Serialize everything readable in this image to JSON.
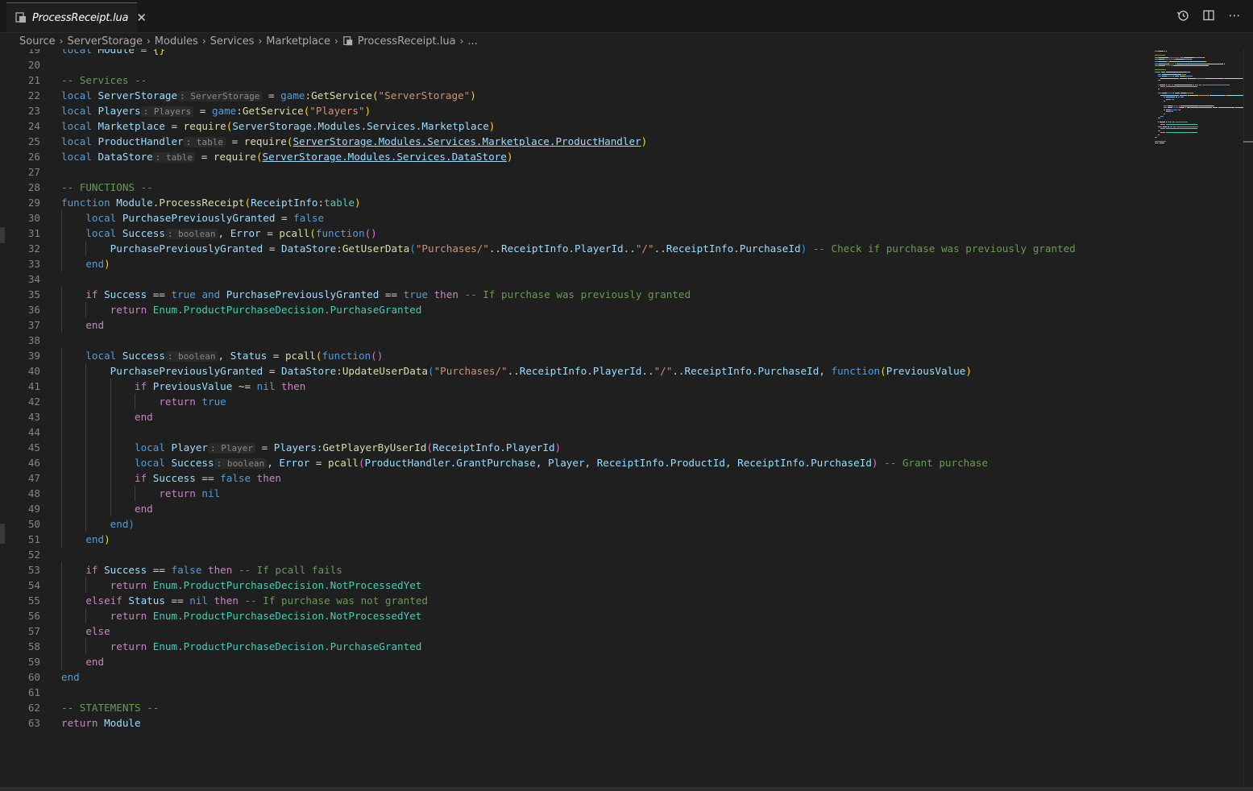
{
  "tab": {
    "title": "ProcessReceipt.lua",
    "close": "✕"
  },
  "actions": {
    "history": "⟲",
    "split": "◫",
    "more": "⋯"
  },
  "breadcrumb": [
    "Source",
    "ServerStorage",
    "Modules",
    "Services",
    "Marketplace",
    "ProcessReceipt.lua",
    "..."
  ],
  "code_lines": [
    {
      "n": "19",
      "t": [
        [
          "kw",
          "local "
        ],
        [
          "id",
          "Module "
        ],
        [
          "pl",
          "= "
        ],
        [
          "br1",
          "{}"
        ]
      ]
    },
    {
      "n": "20",
      "t": []
    },
    {
      "n": "21",
      "t": [
        [
          "cm",
          "-- Services --"
        ]
      ]
    },
    {
      "n": "22",
      "t": [
        [
          "kw",
          "local "
        ],
        [
          "id",
          "ServerStorage"
        ],
        [
          "hint",
          ": ServerStorage"
        ],
        [
          "pl",
          " = "
        ],
        [
          "kw",
          "game"
        ],
        [
          "pl",
          ":"
        ],
        [
          "fn",
          "GetService"
        ],
        [
          "br1",
          "("
        ],
        [
          "str",
          "\"ServerStorage\""
        ],
        [
          "br1",
          ")"
        ]
      ]
    },
    {
      "n": "23",
      "t": [
        [
          "kw",
          "local "
        ],
        [
          "id",
          "Players"
        ],
        [
          "hint",
          ": Players"
        ],
        [
          "pl",
          " = "
        ],
        [
          "kw",
          "game"
        ],
        [
          "pl",
          ":"
        ],
        [
          "fn",
          "GetService"
        ],
        [
          "br1",
          "("
        ],
        [
          "str",
          "\"Players\""
        ],
        [
          "br1",
          ")"
        ]
      ]
    },
    {
      "n": "24",
      "t": [
        [
          "kw",
          "local "
        ],
        [
          "id",
          "Marketplace "
        ],
        [
          "pl",
          "= "
        ],
        [
          "fn",
          "require"
        ],
        [
          "br1",
          "("
        ],
        [
          "id",
          "ServerStorage.Modules.Services.Marketplace"
        ],
        [
          "br1",
          ")"
        ]
      ]
    },
    {
      "n": "25",
      "t": [
        [
          "kw",
          "local "
        ],
        [
          "id",
          "ProductHandler"
        ],
        [
          "hint",
          ": table"
        ],
        [
          "pl",
          " = "
        ],
        [
          "fn",
          "require"
        ],
        [
          "br1",
          "("
        ],
        [
          "idu",
          "ServerStorage.Modules.Services.Marketplace.ProductHandler"
        ],
        [
          "br1",
          ")"
        ]
      ]
    },
    {
      "n": "26",
      "t": [
        [
          "kw",
          "local "
        ],
        [
          "id",
          "DataStore"
        ],
        [
          "hint",
          ": table"
        ],
        [
          "pl",
          " = "
        ],
        [
          "fn",
          "require"
        ],
        [
          "br1",
          "("
        ],
        [
          "idu",
          "ServerStorage.Modules.Services.DataStore"
        ],
        [
          "br1",
          ")"
        ]
      ]
    },
    {
      "n": "27",
      "t": []
    },
    {
      "n": "28",
      "t": [
        [
          "cm",
          "-- FUNCTIONS --"
        ]
      ]
    },
    {
      "n": "29",
      "t": [
        [
          "kw",
          "function "
        ],
        [
          "id",
          "Module"
        ],
        [
          "pl",
          "."
        ],
        [
          "fn",
          "ProcessReceipt"
        ],
        [
          "br1",
          "("
        ],
        [
          "id",
          "ReceiptInfo"
        ],
        [
          "pl",
          ":"
        ],
        [
          "ty",
          "table"
        ],
        [
          "br1",
          ")"
        ]
      ]
    },
    {
      "n": "30",
      "g": [
        0
      ],
      "t": [
        [
          "pl",
          "    "
        ],
        [
          "kw",
          "local "
        ],
        [
          "id",
          "PurchasePreviouslyGranted "
        ],
        [
          "pl",
          "= "
        ],
        [
          "kw",
          "false"
        ]
      ]
    },
    {
      "n": "31",
      "g": [
        0
      ],
      "t": [
        [
          "pl",
          "    "
        ],
        [
          "kw",
          "local "
        ],
        [
          "id",
          "Success"
        ],
        [
          "hint",
          ": boolean"
        ],
        [
          "pl",
          ", "
        ],
        [
          "id",
          "Error "
        ],
        [
          "pl",
          "= "
        ],
        [
          "fn",
          "pcall"
        ],
        [
          "br1",
          "("
        ],
        [
          "kw",
          "function"
        ],
        [
          "br2",
          "()"
        ]
      ]
    },
    {
      "n": "32",
      "g": [
        0,
        1
      ],
      "t": [
        [
          "pl",
          "        "
        ],
        [
          "id",
          "PurchasePreviouslyGranted "
        ],
        [
          "pl",
          "= "
        ],
        [
          "id",
          "DataStore"
        ],
        [
          "pl",
          ":"
        ],
        [
          "fn",
          "GetUserData"
        ],
        [
          "br3",
          "("
        ],
        [
          "str",
          "\"Purchases/\""
        ],
        [
          "pl",
          ".."
        ],
        [
          "id",
          "ReceiptInfo.PlayerId"
        ],
        [
          "pl",
          ".."
        ],
        [
          "str",
          "\"/\""
        ],
        [
          "pl",
          ".."
        ],
        [
          "id",
          "ReceiptInfo.PurchaseId"
        ],
        [
          "br3",
          ")"
        ],
        [
          "cm",
          " -- Check if purchase was previously granted"
        ]
      ]
    },
    {
      "n": "33",
      "g": [
        0
      ],
      "t": [
        [
          "pl",
          "    "
        ],
        [
          "kw",
          "end"
        ],
        [
          "br1",
          ")"
        ]
      ]
    },
    {
      "n": "34",
      "t": []
    },
    {
      "n": "35",
      "g": [
        0
      ],
      "t": [
        [
          "pl",
          "    "
        ],
        [
          "ctl",
          "if "
        ],
        [
          "id",
          "Success "
        ],
        [
          "pl",
          "== "
        ],
        [
          "kw",
          "true "
        ],
        [
          "kw",
          "and "
        ],
        [
          "id",
          "PurchasePreviouslyGranted "
        ],
        [
          "pl",
          "== "
        ],
        [
          "kw",
          "true "
        ],
        [
          "ctl",
          "then "
        ],
        [
          "cm",
          "-- If purchase was previously granted"
        ]
      ]
    },
    {
      "n": "36",
      "g": [
        0,
        1
      ],
      "t": [
        [
          "pl",
          "        "
        ],
        [
          "ctl",
          "return "
        ],
        [
          "ty",
          "Enum.ProductPurchaseDecision.PurchaseGranted"
        ]
      ]
    },
    {
      "n": "37",
      "g": [
        0
      ],
      "t": [
        [
          "pl",
          "    "
        ],
        [
          "ctl",
          "end"
        ]
      ]
    },
    {
      "n": "38",
      "t": []
    },
    {
      "n": "39",
      "g": [
        0
      ],
      "t": [
        [
          "pl",
          "    "
        ],
        [
          "kw",
          "local "
        ],
        [
          "id",
          "Success"
        ],
        [
          "hint",
          ": boolean"
        ],
        [
          "pl",
          ", "
        ],
        [
          "id",
          "Status "
        ],
        [
          "pl",
          "= "
        ],
        [
          "fn",
          "pcall"
        ],
        [
          "br1",
          "("
        ],
        [
          "kw",
          "function"
        ],
        [
          "br2",
          "()"
        ]
      ]
    },
    {
      "n": "40",
      "g": [
        0,
        1
      ],
      "t": [
        [
          "pl",
          "        "
        ],
        [
          "id",
          "PurchasePreviouslyGranted "
        ],
        [
          "pl",
          "= "
        ],
        [
          "id",
          "DataStore"
        ],
        [
          "pl",
          ":"
        ],
        [
          "fn",
          "UpdateUserData"
        ],
        [
          "br3",
          "("
        ],
        [
          "str",
          "\"Purchases/\""
        ],
        [
          "pl",
          ".."
        ],
        [
          "id",
          "ReceiptInfo.PlayerId"
        ],
        [
          "pl",
          ".."
        ],
        [
          "str",
          "\"/\""
        ],
        [
          "pl",
          ".."
        ],
        [
          "id",
          "ReceiptInfo.PurchaseId"
        ],
        [
          "pl",
          ", "
        ],
        [
          "kw",
          "function"
        ],
        [
          "br1",
          "("
        ],
        [
          "id",
          "PreviousValue"
        ],
        [
          "br1",
          ")"
        ]
      ]
    },
    {
      "n": "41",
      "g": [
        0,
        1,
        2
      ],
      "t": [
        [
          "pl",
          "            "
        ],
        [
          "ctl",
          "if "
        ],
        [
          "id",
          "PreviousValue "
        ],
        [
          "pl",
          "~= "
        ],
        [
          "kw",
          "nil "
        ],
        [
          "ctl",
          "then"
        ]
      ]
    },
    {
      "n": "42",
      "g": [
        0,
        1,
        2,
        3
      ],
      "t": [
        [
          "pl",
          "                "
        ],
        [
          "ctl",
          "return "
        ],
        [
          "kw",
          "true"
        ]
      ]
    },
    {
      "n": "43",
      "g": [
        0,
        1,
        2
      ],
      "t": [
        [
          "pl",
          "            "
        ],
        [
          "ctl",
          "end"
        ]
      ]
    },
    {
      "n": "44",
      "g": [
        0,
        1,
        2
      ],
      "t": []
    },
    {
      "n": "45",
      "g": [
        0,
        1,
        2
      ],
      "t": [
        [
          "pl",
          "            "
        ],
        [
          "kw",
          "local "
        ],
        [
          "id",
          "Player"
        ],
        [
          "hint",
          ": Player"
        ],
        [
          "pl",
          " = "
        ],
        [
          "id",
          "Players"
        ],
        [
          "pl",
          ":"
        ],
        [
          "fn",
          "GetPlayerByUserId"
        ],
        [
          "br2",
          "("
        ],
        [
          "id",
          "ReceiptInfo.PlayerId"
        ],
        [
          "br2",
          ")"
        ]
      ]
    },
    {
      "n": "46",
      "g": [
        0,
        1,
        2
      ],
      "t": [
        [
          "pl",
          "            "
        ],
        [
          "kw",
          "local "
        ],
        [
          "id",
          "Success"
        ],
        [
          "hint",
          ": boolean"
        ],
        [
          "pl",
          ", "
        ],
        [
          "id",
          "Error "
        ],
        [
          "pl",
          "= "
        ],
        [
          "fn",
          "pcall"
        ],
        [
          "br2",
          "("
        ],
        [
          "id",
          "ProductHandler.GrantPurchase"
        ],
        [
          "pl",
          ", "
        ],
        [
          "id",
          "Player"
        ],
        [
          "pl",
          ", "
        ],
        [
          "id",
          "ReceiptInfo.ProductId"
        ],
        [
          "pl",
          ", "
        ],
        [
          "id",
          "ReceiptInfo.PurchaseId"
        ],
        [
          "br2",
          ")"
        ],
        [
          "cm",
          " -- Grant purchase"
        ]
      ]
    },
    {
      "n": "47",
      "g": [
        0,
        1,
        2
      ],
      "t": [
        [
          "pl",
          "            "
        ],
        [
          "ctl",
          "if "
        ],
        [
          "id",
          "Success "
        ],
        [
          "pl",
          "== "
        ],
        [
          "kw",
          "false "
        ],
        [
          "ctl",
          "then"
        ]
      ]
    },
    {
      "n": "48",
      "g": [
        0,
        1,
        2,
        3
      ],
      "t": [
        [
          "pl",
          "                "
        ],
        [
          "ctl",
          "return "
        ],
        [
          "kw",
          "nil"
        ]
      ]
    },
    {
      "n": "49",
      "g": [
        0,
        1,
        2
      ],
      "t": [
        [
          "pl",
          "            "
        ],
        [
          "ctl",
          "end"
        ]
      ]
    },
    {
      "n": "50",
      "g": [
        0,
        1
      ],
      "t": [
        [
          "pl",
          "        "
        ],
        [
          "kw",
          "end"
        ],
        [
          "br3",
          ")"
        ]
      ]
    },
    {
      "n": "51",
      "g": [
        0
      ],
      "t": [
        [
          "pl",
          "    "
        ],
        [
          "kw",
          "end"
        ],
        [
          "br1",
          ")"
        ]
      ]
    },
    {
      "n": "52",
      "t": []
    },
    {
      "n": "53",
      "g": [
        0
      ],
      "t": [
        [
          "pl",
          "    "
        ],
        [
          "ctl",
          "if "
        ],
        [
          "id",
          "Success "
        ],
        [
          "pl",
          "== "
        ],
        [
          "kw",
          "false "
        ],
        [
          "ctl",
          "then "
        ],
        [
          "cm",
          "-- If pcall fails"
        ]
      ]
    },
    {
      "n": "54",
      "g": [
        0,
        1
      ],
      "t": [
        [
          "pl",
          "        "
        ],
        [
          "ctl",
          "return "
        ],
        [
          "ty",
          "Enum.ProductPurchaseDecision.NotProcessedYet"
        ]
      ]
    },
    {
      "n": "55",
      "g": [
        0
      ],
      "t": [
        [
          "pl",
          "    "
        ],
        [
          "ctl",
          "elseif "
        ],
        [
          "id",
          "Status "
        ],
        [
          "pl",
          "== "
        ],
        [
          "kw",
          "nil "
        ],
        [
          "ctl",
          "then "
        ],
        [
          "cm",
          "-- If purchase was not granted"
        ]
      ]
    },
    {
      "n": "56",
      "g": [
        0,
        1
      ],
      "t": [
        [
          "pl",
          "        "
        ],
        [
          "ctl",
          "return "
        ],
        [
          "ty",
          "Enum.ProductPurchaseDecision.NotProcessedYet"
        ]
      ]
    },
    {
      "n": "57",
      "g": [
        0
      ],
      "t": [
        [
          "pl",
          "    "
        ],
        [
          "ctl",
          "else"
        ]
      ]
    },
    {
      "n": "58",
      "g": [
        0,
        1
      ],
      "t": [
        [
          "pl",
          "        "
        ],
        [
          "ctl",
          "return "
        ],
        [
          "ty",
          "Enum.ProductPurchaseDecision.PurchaseGranted"
        ]
      ]
    },
    {
      "n": "59",
      "g": [
        0
      ],
      "t": [
        [
          "pl",
          "    "
        ],
        [
          "ctl",
          "end"
        ]
      ]
    },
    {
      "n": "60",
      "t": [
        [
          "kw",
          "end"
        ]
      ]
    },
    {
      "n": "61",
      "t": []
    },
    {
      "n": "62",
      "t": [
        [
          "cm",
          "-- STATEMENTS --"
        ]
      ]
    },
    {
      "n": "63",
      "t": [
        [
          "ctl",
          "return "
        ],
        [
          "id",
          "Module"
        ]
      ]
    }
  ],
  "colors": {
    "accent": "#0078d4",
    "background": "#1f1f1f",
    "keyword": "#569cd6",
    "control": "#c586c0",
    "string": "#ce9178",
    "comment": "#6a9955",
    "function": "#dcdcaa",
    "identifier": "#9cdcfe",
    "type": "#4ec9b0"
  }
}
